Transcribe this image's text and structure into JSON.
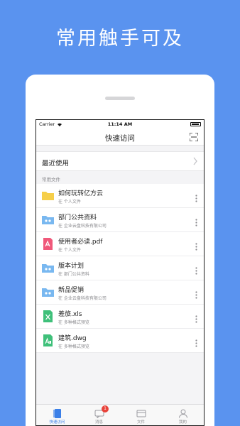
{
  "headline": "常用触手可及",
  "status_bar": {
    "carrier": "Carrier",
    "time": "11:14 AM"
  },
  "nav": {
    "title": "快速访问"
  },
  "recent": {
    "label": "最近使用"
  },
  "section": {
    "label": "常用文件"
  },
  "files": [
    {
      "name": "如何玩转亿方云",
      "location": "在 个人文件",
      "icon": "folder-icon",
      "color": "#f6cf4a"
    },
    {
      "name": "部门公共资料",
      "location": "在 企业云盘科技有限公司",
      "icon": "shared-folder-icon",
      "color": "#79b8f0"
    },
    {
      "name": "使用者必读.pdf",
      "location": "在 个人文件",
      "icon": "pdf-icon",
      "color": "#f0587a"
    },
    {
      "name": "版本计划",
      "location": "在 部门公共资料",
      "icon": "shared-folder-icon",
      "color": "#79b8f0"
    },
    {
      "name": "新品促销",
      "location": "在 企业云盘科技有限公司",
      "icon": "shared-folder-icon",
      "color": "#79b8f0"
    },
    {
      "name": "差旅.xls",
      "location": "在 多种格式预览",
      "icon": "excel-icon",
      "color": "#3fc07a"
    },
    {
      "name": "建筑.dwg",
      "location": "在 多种格式预览",
      "icon": "dwg-icon",
      "color": "#3fc07a"
    }
  ],
  "tabs": [
    {
      "label": "快速访问",
      "icon": "quick-access-icon",
      "active": true
    },
    {
      "label": "消息",
      "icon": "message-icon",
      "badge": "1"
    },
    {
      "label": "文件",
      "icon": "folder-tab-icon"
    },
    {
      "label": "我的",
      "icon": "person-icon"
    }
  ],
  "colors": {
    "background": "#5a93ef",
    "accent": "#3a7fe8",
    "badge": "#e8423a"
  }
}
